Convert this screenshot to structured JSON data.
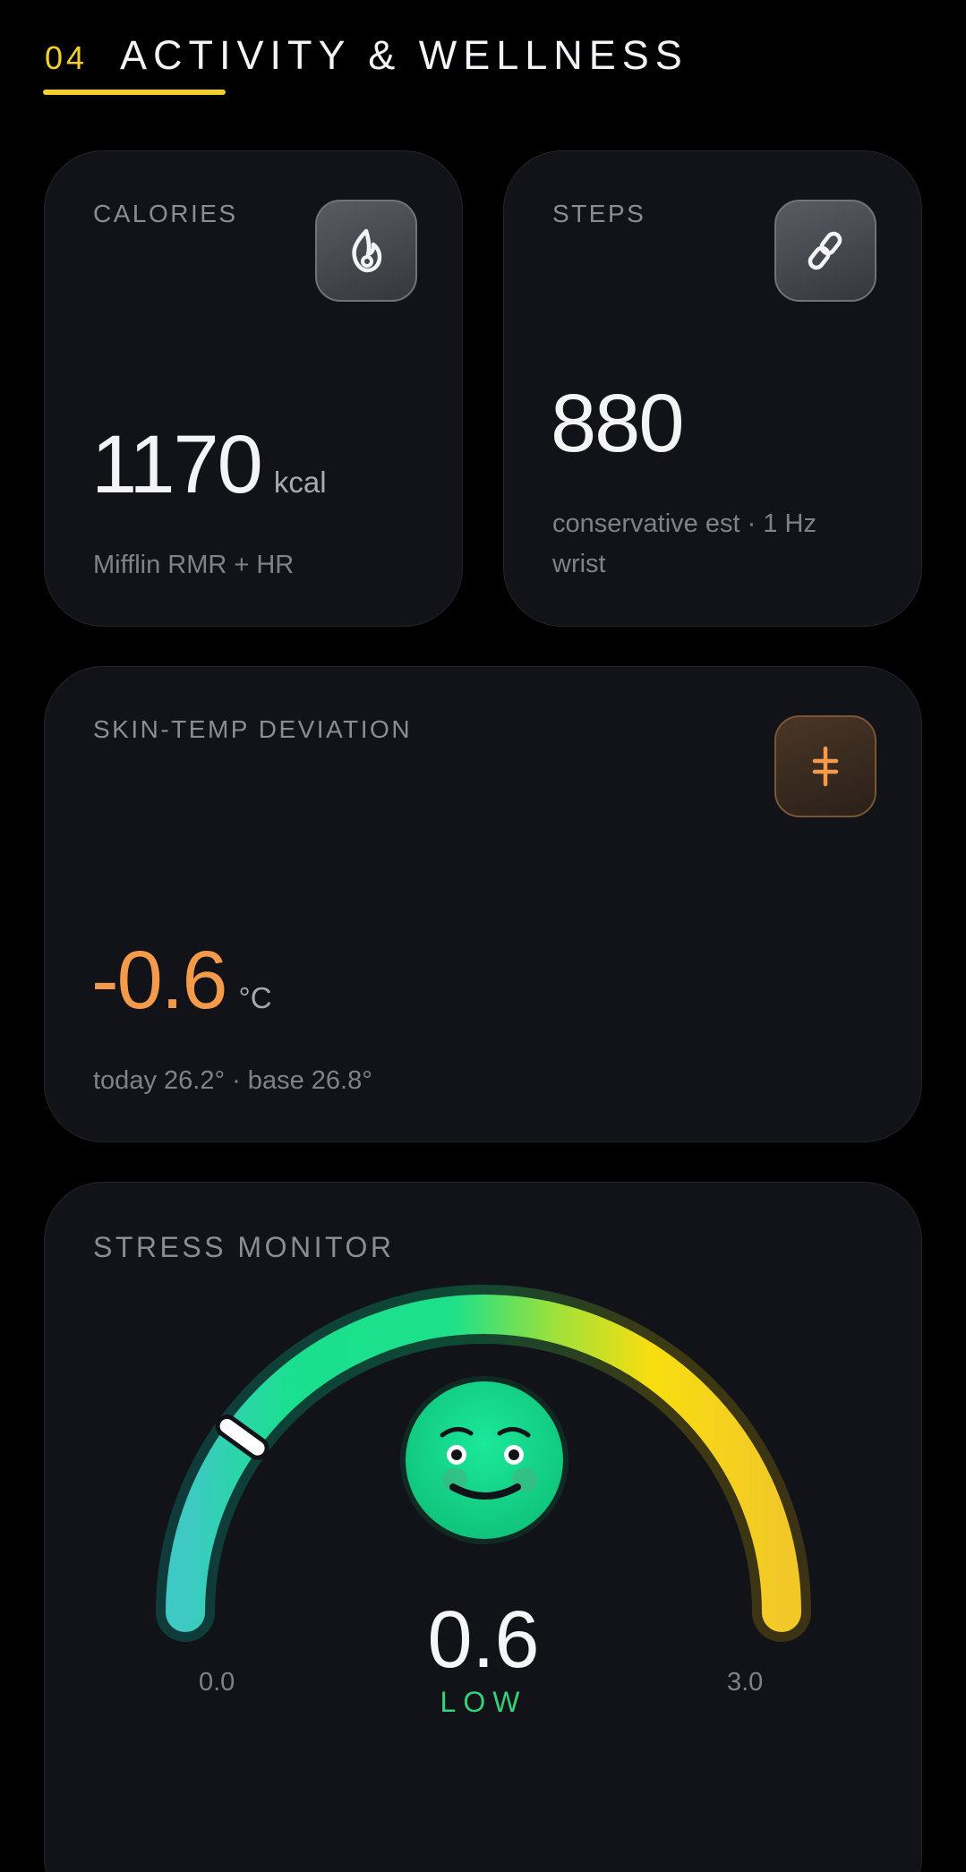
{
  "section": {
    "number": "04",
    "title": "ACTIVITY & WELLNESS"
  },
  "colors": {
    "accent_yellow": "#f2d12e",
    "card_bg": "#111318",
    "temp_orange": "#f39b4a",
    "stress_green": "#34d17a"
  },
  "calories": {
    "label": "CALORIES",
    "icon": "flame-icon",
    "value": "1170",
    "unit": "kcal",
    "note": "Mifflin RMR + HR"
  },
  "steps": {
    "label": "STEPS",
    "icon": "footprints-icon",
    "value": "880",
    "note_line1": "conservative est · 1 Hz",
    "note_line2": "wrist"
  },
  "skin_temp": {
    "label": "SKIN-TEMP DEVIATION",
    "icon": "thermometer-icon",
    "value": "-0.6",
    "unit": "°C",
    "note": "today 26.2° · base 26.8°"
  },
  "stress": {
    "label": "STRESS MONITOR",
    "value": "0.6",
    "level": "LOW",
    "min": "0.0",
    "max": "3.0",
    "scale_min": 0,
    "scale_max": 3,
    "current": 0.6,
    "face_icon": "smiley-face-icon"
  }
}
